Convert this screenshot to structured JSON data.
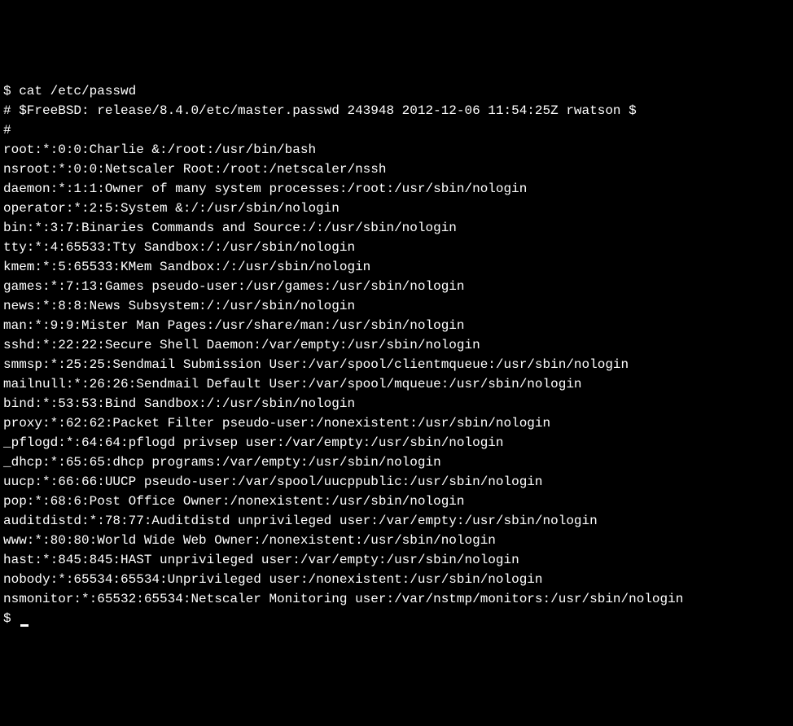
{
  "terminal": {
    "prompt": "$ ",
    "command": "cat /etc/passwd",
    "lines": [
      "# $FreeBSD: release/8.4.0/etc/master.passwd 243948 2012-12-06 11:54:25Z rwatson $",
      "#",
      "root:*:0:0:Charlie &:/root:/usr/bin/bash",
      "nsroot:*:0:0:Netscaler Root:/root:/netscaler/nssh",
      "daemon:*:1:1:Owner of many system processes:/root:/usr/sbin/nologin",
      "operator:*:2:5:System &:/:/usr/sbin/nologin",
      "bin:*:3:7:Binaries Commands and Source:/:/usr/sbin/nologin",
      "tty:*:4:65533:Tty Sandbox:/:/usr/sbin/nologin",
      "kmem:*:5:65533:KMem Sandbox:/:/usr/sbin/nologin",
      "games:*:7:13:Games pseudo-user:/usr/games:/usr/sbin/nologin",
      "news:*:8:8:News Subsystem:/:/usr/sbin/nologin",
      "man:*:9:9:Mister Man Pages:/usr/share/man:/usr/sbin/nologin",
      "sshd:*:22:22:Secure Shell Daemon:/var/empty:/usr/sbin/nologin",
      "smmsp:*:25:25:Sendmail Submission User:/var/spool/clientmqueue:/usr/sbin/nologin",
      "mailnull:*:26:26:Sendmail Default User:/var/spool/mqueue:/usr/sbin/nologin",
      "bind:*:53:53:Bind Sandbox:/:/usr/sbin/nologin",
      "proxy:*:62:62:Packet Filter pseudo-user:/nonexistent:/usr/sbin/nologin",
      "_pflogd:*:64:64:pflogd privsep user:/var/empty:/usr/sbin/nologin",
      "_dhcp:*:65:65:dhcp programs:/var/empty:/usr/sbin/nologin",
      "uucp:*:66:66:UUCP pseudo-user:/var/spool/uucppublic:/usr/sbin/nologin",
      "pop:*:68:6:Post Office Owner:/nonexistent:/usr/sbin/nologin",
      "auditdistd:*:78:77:Auditdistd unprivileged user:/var/empty:/usr/sbin/nologin",
      "www:*:80:80:World Wide Web Owner:/nonexistent:/usr/sbin/nologin",
      "hast:*:845:845:HAST unprivileged user:/var/empty:/usr/sbin/nologin",
      "nobody:*:65534:65534:Unprivileged user:/nonexistent:/usr/sbin/nologin",
      "nsmonitor:*:65532:65534:Netscaler Monitoring user:/var/nstmp/monitors:/usr/sbin/nologin"
    ],
    "final_prompt": "$ "
  }
}
